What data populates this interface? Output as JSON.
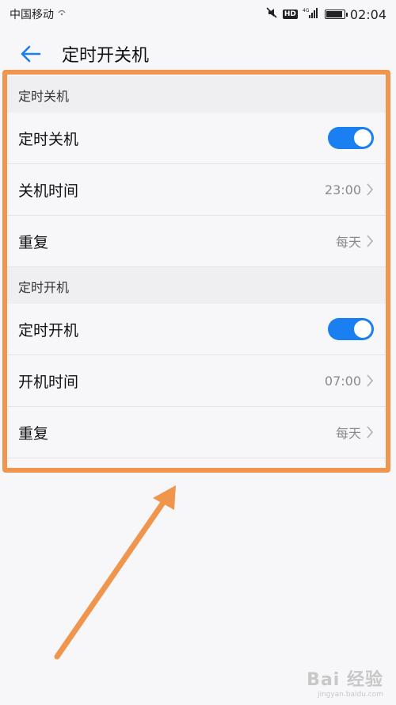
{
  "status_bar": {
    "carrier": "中国移动",
    "network": "4G",
    "hd": "HD",
    "time": "02:04"
  },
  "header": {
    "title": "定时开关机",
    "back_icon": "arrow-left-icon"
  },
  "sections": [
    {
      "header": "定时关机",
      "toggle_label": "定时关机",
      "toggle_on": true,
      "time_label": "关机时间",
      "time_value": "23:00",
      "repeat_label": "重复",
      "repeat_value": "每天"
    },
    {
      "header": "定时开机",
      "toggle_label": "定时开机",
      "toggle_on": true,
      "time_label": "开机时间",
      "time_value": "07:00",
      "repeat_label": "重复",
      "repeat_value": "每天"
    }
  ],
  "watermark": {
    "brand": "Bai 经验",
    "url": "jingyan.baidu.com"
  },
  "colors": {
    "accent": "#1a7ff0",
    "annotation": "#f0954d",
    "secondary_text": "#8a8a8a",
    "section_bg": "#efeef1"
  }
}
